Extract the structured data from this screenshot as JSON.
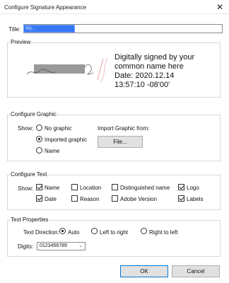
{
  "window": {
    "title": "Configure Signature Appearance",
    "close_glyph": "✕"
  },
  "title_field": {
    "label": "Title:",
    "value": "My..."
  },
  "preview": {
    "group_label": "Preview",
    "signature_lines": [
      "Digitally signed by your",
      "common name here",
      "Date: 2020.12.14",
      "13:57:10 -08'00'"
    ]
  },
  "configure_graphic": {
    "group_label": "Configure Graphic",
    "show_label": "Show:",
    "options": [
      {
        "label": "No graphic",
        "selected": false
      },
      {
        "label": "Imported graphic",
        "selected": true
      },
      {
        "label": "Name",
        "selected": false
      }
    ],
    "import_label": "Import Graphic from:",
    "file_button": "File..."
  },
  "configure_text": {
    "group_label": "Configure Text",
    "show_label": "Show:",
    "checkboxes": [
      {
        "label": "Name",
        "checked": true
      },
      {
        "label": "Location",
        "checked": false
      },
      {
        "label": "Distinguished name",
        "checked": false
      },
      {
        "label": "Logo",
        "checked": true
      },
      {
        "label": "Date",
        "checked": true
      },
      {
        "label": "Reason",
        "checked": false
      },
      {
        "label": "Adobe Version",
        "checked": false
      },
      {
        "label": "Labels",
        "checked": true
      }
    ]
  },
  "text_properties": {
    "group_label": "Text Properties",
    "direction_label": "Text Direction:",
    "directions": [
      {
        "label": "Auto",
        "selected": true
      },
      {
        "label": "Left to right",
        "selected": false
      },
      {
        "label": "Right to left",
        "selected": false
      }
    ],
    "digits_label": "Digits:",
    "digits_value": "0123456789"
  },
  "buttons": {
    "ok": "OK",
    "cancel": "Cancel"
  }
}
